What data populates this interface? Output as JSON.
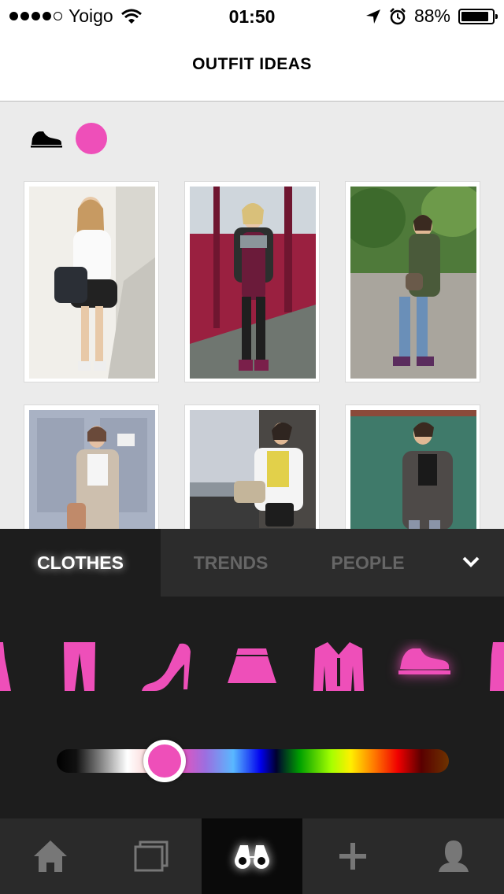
{
  "status_bar": {
    "carrier": "Yoigo",
    "time": "01:50",
    "battery": "88%",
    "signal_bars_filled": 4,
    "signal_bars_total": 5
  },
  "header": {
    "title": "OUTFIT IDEAS"
  },
  "filters": {
    "category_icon": "sneaker-icon",
    "color": "#ee4fb9"
  },
  "panel": {
    "tabs": [
      {
        "label": "CLOTHES",
        "active": true
      },
      {
        "label": "TRENDS",
        "active": false
      },
      {
        "label": "PEOPLE",
        "active": false
      }
    ],
    "categories": [
      "dress-icon",
      "pants-icon",
      "high-heel-icon",
      "skirt-icon",
      "blazer-icon",
      "sneaker-icon",
      "top-icon"
    ],
    "selected_category": "sneaker-icon",
    "color_slider": {
      "selected_color": "#ee4fb9"
    }
  },
  "bottom_tabbar": {
    "items": [
      "home-icon",
      "photos-icon",
      "binoculars-icon",
      "add-icon",
      "profile-icon"
    ],
    "active": "binoculars-icon"
  },
  "colors": {
    "accent": "#ee4fb9",
    "panel_bg": "#1d1d1d",
    "tabbar_bg": "#2a2a2a"
  }
}
